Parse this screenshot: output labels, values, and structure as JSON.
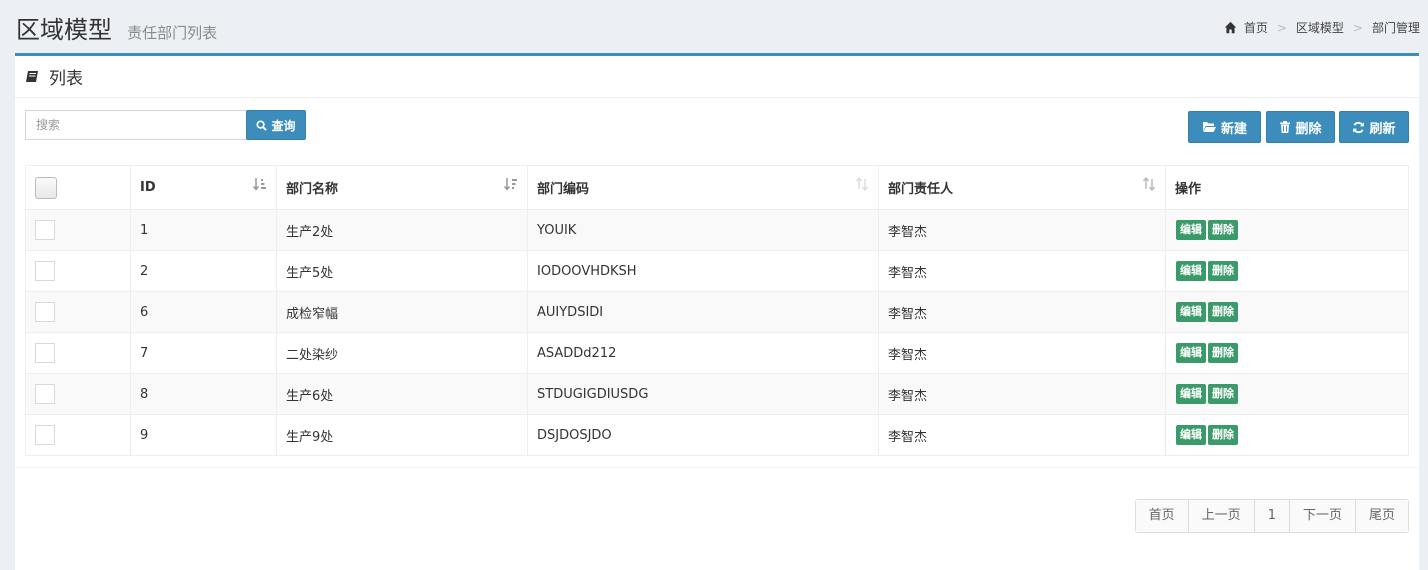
{
  "header": {
    "title": "区域模型",
    "subtitle": "责任部门列表"
  },
  "breadcrumb": {
    "home": "首页",
    "level1": "区域模型",
    "level2": "部门管理"
  },
  "box": {
    "title": "列表"
  },
  "search": {
    "placeholder": "搜索",
    "button": "查询"
  },
  "toolbar": {
    "new": "新建",
    "delete": "删除",
    "refresh": "刷新"
  },
  "table": {
    "headers": {
      "id": "ID",
      "name": "部门名称",
      "code": "部门编码",
      "owner": "部门责任人",
      "ops": "操作"
    },
    "rows": [
      {
        "id": "1",
        "name": "生产2处",
        "code": "YOUIK",
        "owner": "李智杰"
      },
      {
        "id": "2",
        "name": "生产5处",
        "code": "IODOOVHDKSH",
        "owner": "李智杰"
      },
      {
        "id": "6",
        "name": "成检窄幅",
        "code": "AUIYDSIDI",
        "owner": "李智杰"
      },
      {
        "id": "7",
        "name": "二处染纱",
        "code": "ASADDd212",
        "owner": "李智杰"
      },
      {
        "id": "8",
        "name": "生产6处",
        "code": "STDUGIGDIUSDG",
        "owner": "李智杰"
      },
      {
        "id": "9",
        "name": "生产9处",
        "code": "DSJDOSJDO",
        "owner": "李智杰"
      }
    ],
    "edit_label": "编辑",
    "delete_label": "删除"
  },
  "pagination": {
    "first": "首页",
    "prev": "上一页",
    "current": "1",
    "next": "下一页",
    "last": "尾页"
  },
  "colors": {
    "primary": "#3c8dbc",
    "success": "#3a9a6a",
    "background": "#ecf0f5"
  }
}
